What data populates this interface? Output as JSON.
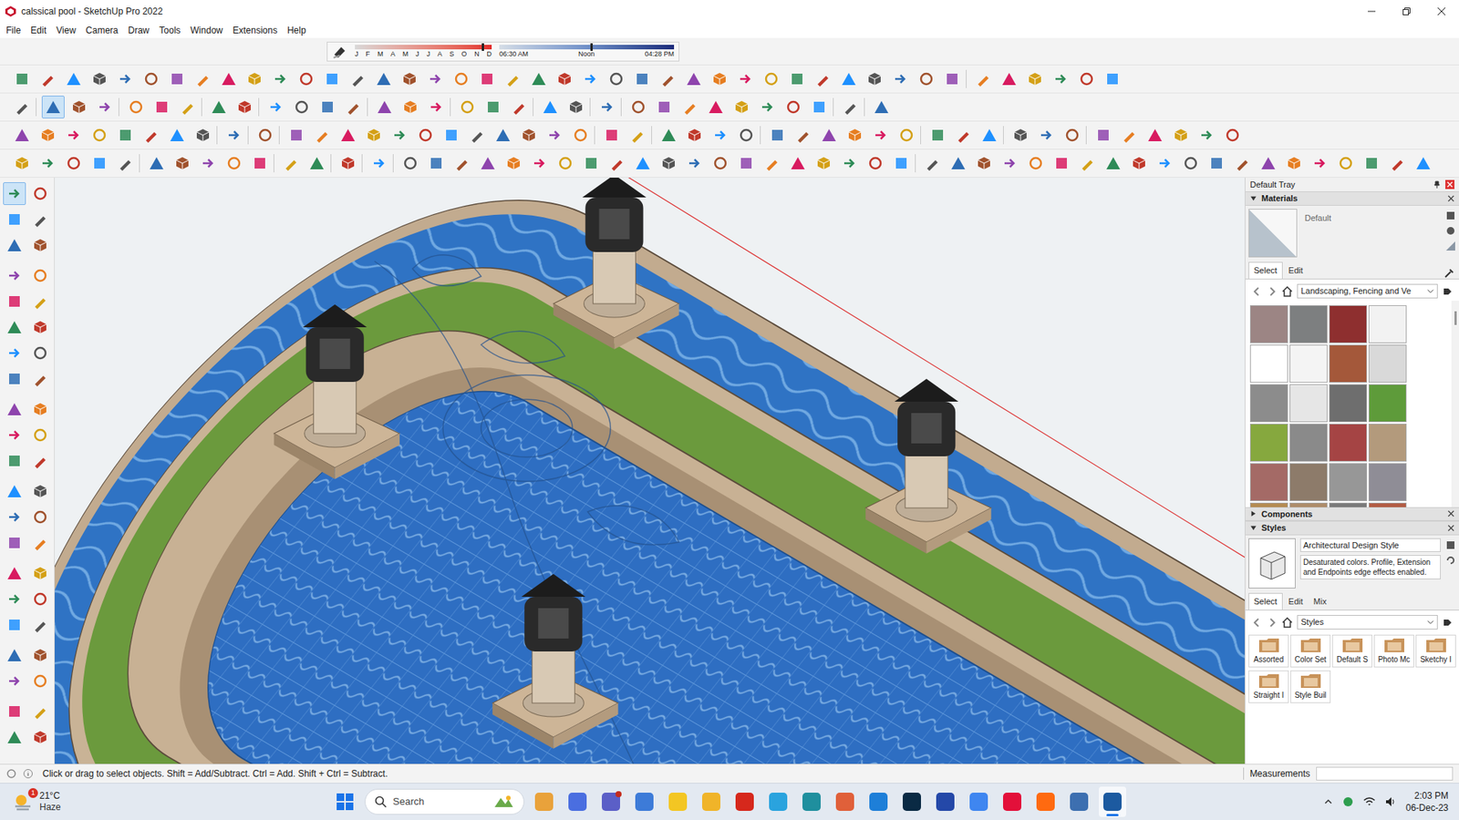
{
  "window": {
    "title": "calssical pool - SketchUp Pro 2022"
  },
  "menu": [
    "File",
    "Edit",
    "View",
    "Camera",
    "Draw",
    "Tools",
    "Window",
    "Extensions",
    "Help"
  ],
  "shadows": {
    "months": [
      "J",
      "F",
      "M",
      "A",
      "M",
      "J",
      "J",
      "A",
      "S",
      "O",
      "N",
      "D"
    ],
    "date_level": 0.93,
    "times": [
      "06:30 AM",
      "Noon",
      "04:28 PM"
    ],
    "time_level": 0.52
  },
  "select_tool": {
    "active": true
  },
  "tray": {
    "title": "Default Tray"
  },
  "materials": {
    "title": "Materials",
    "expanded": true,
    "current": "Default",
    "tabs": [
      {
        "label": "Select",
        "selected": true
      },
      {
        "label": "Edit",
        "selected": false
      }
    ],
    "library": "Landscaping, Fencing and Ve",
    "swatches": [
      {
        "color": "#9c8584"
      },
      {
        "color": "#7d7f80"
      },
      {
        "color": "#8e2f2f"
      },
      {
        "color": "#f2f2f2"
      },
      {
        "color": "#ffffff"
      },
      {
        "color": "#f4f4f4"
      },
      {
        "color": "#a4583a"
      },
      {
        "color": "#d9d9d9"
      },
      {
        "color": "#8c8c8c"
      },
      {
        "color": "#e6e6e6"
      },
      {
        "color": "#6e6e6e"
      },
      {
        "color": "#5e9b3a"
      },
      {
        "color": "#86a83e"
      },
      {
        "color": "#8a8a8a"
      },
      {
        "color": "#a54444"
      },
      {
        "color": "#b39a7c"
      },
      {
        "color": "#a46a66"
      },
      {
        "color": "#8d7b6a"
      },
      {
        "color": "#979797"
      },
      {
        "color": "#8f8d96"
      },
      {
        "color": "#b48b52"
      },
      {
        "color": "#ad8c6a"
      },
      {
        "color": "#7a7a7a"
      },
      {
        "color": "#b25c44"
      }
    ]
  },
  "components": {
    "title": "Components",
    "expanded": false
  },
  "styles": {
    "title": "Styles",
    "expanded": true,
    "current": "Architectural Design Style",
    "description": "Desaturated colors. Profile, Extension and Endpoints edge effects enabled.",
    "tabs": [
      {
        "label": "Select",
        "selected": true
      },
      {
        "label": "Edit",
        "selected": false
      },
      {
        "label": "Mix",
        "selected": false
      }
    ],
    "library": "Styles",
    "folders": [
      "Assorted",
      "Color Set",
      "Default S",
      "Photo Mc",
      "Sketchy I",
      "Straight I",
      "Style Buil"
    ]
  },
  "status_bar": {
    "hint": "Click or drag to select objects. Shift = Add/Subtract. Ctrl = Add. Shift + Ctrl = Subtract.",
    "measurements_label": "Measurements",
    "measurements_value": ""
  },
  "taskbar": {
    "weather": {
      "temp": "21°C",
      "condition": "Haze",
      "badge": "1"
    },
    "search": {
      "placeholder": "Search"
    },
    "apps": [
      {
        "color": "#e9a23b",
        "notify": false,
        "active": false
      },
      {
        "color": "#4a6ee0",
        "notify": false,
        "active": false
      },
      {
        "color": "#5b5fc7",
        "notify": true,
        "active": false
      },
      {
        "color": "#3d7bd8",
        "notify": false,
        "active": false
      },
      {
        "color": "#f3c623",
        "notify": false,
        "active": false
      },
      {
        "color": "#f0b429",
        "notify": false,
        "active": false
      },
      {
        "color": "#d6281c",
        "notify": false,
        "active": false
      },
      {
        "color": "#2aa3de",
        "notify": false,
        "active": false
      },
      {
        "color": "#1f8f9e",
        "notify": false,
        "active": false
      },
      {
        "color": "#e0603a",
        "notify": false,
        "active": false
      },
      {
        "color": "#1e7fd8",
        "notify": false,
        "active": false
      },
      {
        "color": "#0a2a44",
        "notify": false,
        "active": false
      },
      {
        "color": "#2448a8",
        "notify": false,
        "active": false
      },
      {
        "color": "#3f86f0",
        "notify": false,
        "active": false
      },
      {
        "color": "#e3103a",
        "notify": false,
        "active": false
      },
      {
        "color": "#ff6a10",
        "notify": false,
        "active": false
      },
      {
        "color": "#3d6fb0",
        "notify": false,
        "active": false
      },
      {
        "color": "#1c5aa0",
        "notify": false,
        "active": true
      }
    ],
    "clock": {
      "time": "2:03 PM",
      "date": "06-Dec-23"
    }
  }
}
